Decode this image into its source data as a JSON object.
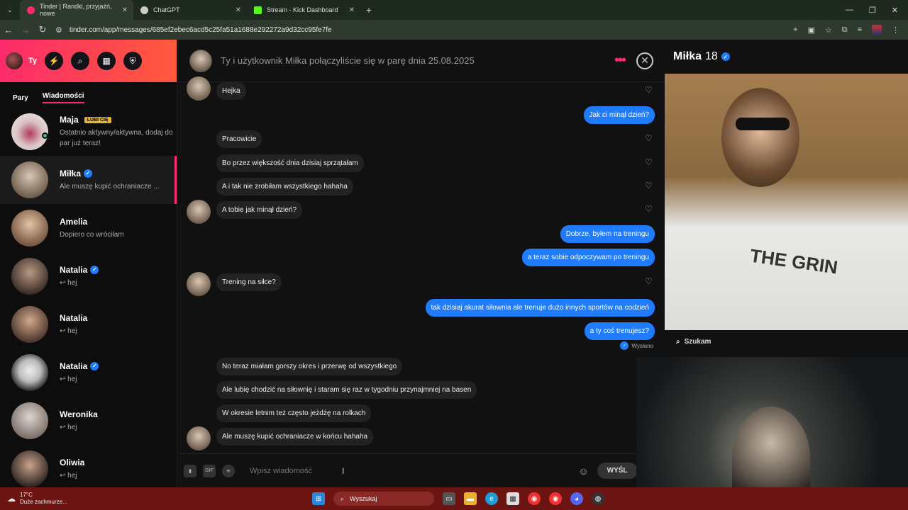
{
  "browser": {
    "tabs": [
      {
        "title": "Tinder | Randki, przyjaźń, nowe",
        "active": true,
        "favicon_color": "#fd2b6b"
      },
      {
        "title": "ChatGPT",
        "active": false,
        "favicon_color": "#cccccc"
      },
      {
        "title": "Stream - Kick Dashboard",
        "active": false,
        "favicon_color": "#53fc18"
      }
    ],
    "url": "tinder.com/app/messages/685ef2ebec6acd5c25fa51a1688e292272a9d32cc95fe7fe"
  },
  "sidebar": {
    "me_label": "Ty",
    "tabs": {
      "pary": "Pary",
      "wiadomosci": "Wiadomości"
    },
    "conversations": [
      {
        "name": "Maja",
        "badge": "LUBI CIĘ",
        "preview": "Ostatnio aktywny/aktywna, dodaj do par już teraz!",
        "verified": false,
        "online": true
      },
      {
        "name": "Miłka",
        "preview": "Ale muszę kupić ochraniacze ...",
        "verified": true,
        "active": true
      },
      {
        "name": "Amelia",
        "preview": "Dopiero co wróciłam",
        "verified": false
      },
      {
        "name": "Natalia",
        "preview": "↩ hej",
        "verified": true
      },
      {
        "name": "Natalia",
        "preview": "↩ hej",
        "verified": false
      },
      {
        "name": "Natalia",
        "preview": "↩ hej",
        "verified": true
      },
      {
        "name": "Weronika",
        "preview": "↩ hej",
        "verified": false
      },
      {
        "name": "Oliwia",
        "preview": "↩ hej",
        "verified": false
      }
    ]
  },
  "chat": {
    "match_text": "Ty i użytkownik Miłka połączyliście się w parę dnia 25.08.2025",
    "messages": [
      {
        "dir": "in",
        "text": "Hejka"
      },
      {
        "dir": "out",
        "text": "Jak ci minął dzień?"
      },
      {
        "dir": "in",
        "text": "Pracowicie"
      },
      {
        "dir": "in",
        "text": "Bo przez większość dnia dzisiaj sprzątałam"
      },
      {
        "dir": "in",
        "text": "A i tak nie zrobiłam wszystkiego hahaha"
      },
      {
        "dir": "in",
        "text": "A tobie jak minął dzień?"
      },
      {
        "dir": "out",
        "text": "Dobrze, byłem na treningu"
      },
      {
        "dir": "out",
        "text": "a teraz sobie odpoczywam po treningu"
      },
      {
        "dir": "in",
        "text": "Trening na siłce?"
      },
      {
        "dir": "out",
        "text": "tak dzisiaj akurat siłownia ale trenuje dużo innych sportów na codzień"
      },
      {
        "dir": "out",
        "text": "a ty coś trenujesz?"
      },
      {
        "dir": "in",
        "text": "No teraz miałam gorszy okres i przerwę od wszystkiego"
      },
      {
        "dir": "in",
        "text": "Ale lubię chodzić na siłownię i staram się raz w tygodniu przynajmniej na basen"
      },
      {
        "dir": "in",
        "text": "W okresie letnim też często jeżdżę na rolkach"
      },
      {
        "dir": "in",
        "text": "Ale muszę kupić ochraniacze w końcu hahaha"
      }
    ],
    "sent_label": "Wysłano",
    "input_placeholder": "Wpisz wiadomość",
    "gif_label": "GIF",
    "send_label": "WYŚL"
  },
  "profile": {
    "name": "Miłka",
    "age": "18",
    "search_label": "Szukam",
    "shirt_text": "THE GRIN"
  },
  "taskbar": {
    "temp": "17°C",
    "weather": "Duże zachmurze...",
    "search_placeholder": "Wyszukaj"
  },
  "colors": {
    "accent": "#fd2b6b",
    "outgoing_bubble": "#1f7cff",
    "taskbar": "#6b1412"
  }
}
